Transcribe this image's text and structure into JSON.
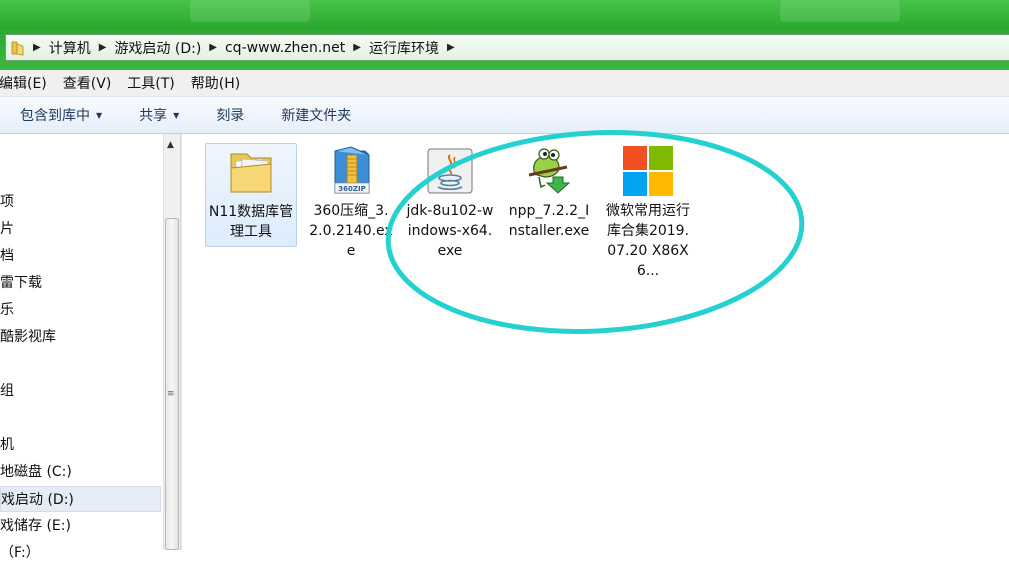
{
  "address": {
    "crumbs": [
      "计算机",
      "游戏启动 (D:)",
      "cq-www.zhen.net",
      "运行库环境"
    ]
  },
  "menu": {
    "items": [
      "编辑(E)",
      "查看(V)",
      "工具(T)",
      "帮助(H)"
    ]
  },
  "toolbar": {
    "include_library": "包含到库中",
    "share": "共享",
    "burn": "刻录",
    "new_folder": "新建文件夹"
  },
  "nav": {
    "items": [
      "项",
      "片",
      "档",
      "雷下载",
      "乐",
      "酷影视库",
      "组",
      "机",
      "地磁盘 (C:)",
      "戏启动 (D:)",
      "戏储存 (E:)",
      "（F:）"
    ]
  },
  "files": [
    {
      "name": "N11数据库管理工具",
      "icon": "folder-icon"
    },
    {
      "name": "360压缩_3.2.0.2140.exe",
      "icon": "360zip-icon",
      "badge": "360ZIP"
    },
    {
      "name": "jdk-8u102-windows-x64.exe",
      "icon": "java-icon"
    },
    {
      "name": "npp_7.2.2_Installer.exe",
      "icon": "notepadpp-icon"
    },
    {
      "name": "微软常用运行库合集2019.07.20 X86X6...",
      "icon": "windows-logo-icon"
    }
  ],
  "colors": {
    "title_green": "#2aa82e",
    "annotation_cyan": "#25d0d0",
    "ms_red": "#f25022",
    "ms_green": "#7fba00",
    "ms_blue": "#00a4ef",
    "ms_yellow": "#ffb900"
  }
}
